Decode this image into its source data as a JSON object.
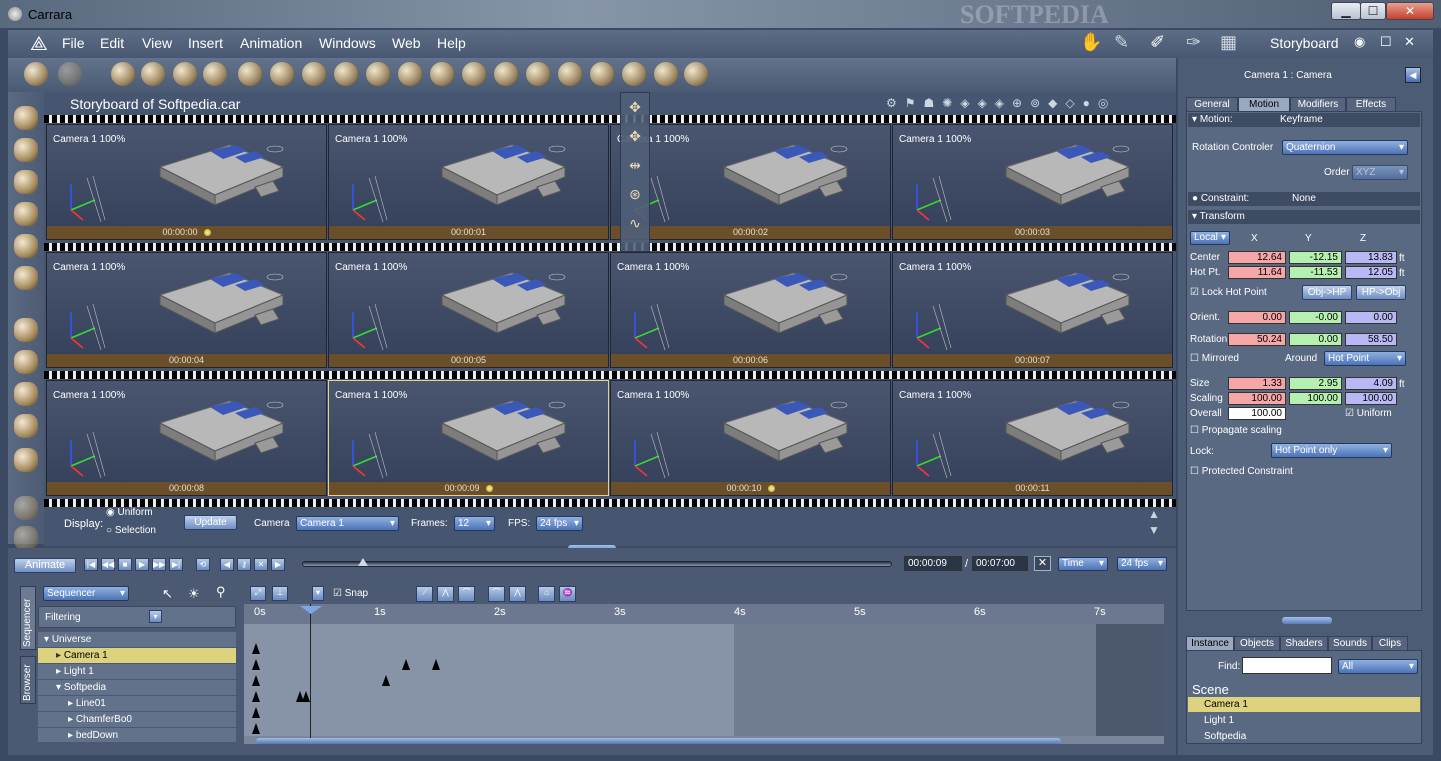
{
  "app": {
    "title": "Carrara",
    "watermark": "SOFTPEDIA"
  },
  "menu": [
    "File",
    "Edit",
    "View",
    "Insert",
    "Animation",
    "Windows",
    "Web",
    "Help"
  ],
  "room": {
    "label": "Storyboard"
  },
  "storyboard": {
    "title": "Storyboard of Softpedia.car",
    "frames": [
      {
        "label": "Camera 1 100%",
        "time": "00:00:00",
        "dot": true
      },
      {
        "label": "Camera 1 100%",
        "time": "00:00:01",
        "dot": false
      },
      {
        "label": "Camera 1 100%",
        "time": "00:00:02",
        "dot": false
      },
      {
        "label": "Camera 1 100%",
        "time": "00:00:03",
        "dot": false
      },
      {
        "label": "Camera 1 100%",
        "time": "00:00:04",
        "dot": false
      },
      {
        "label": "Camera 1 100%",
        "time": "00:00:05",
        "dot": false
      },
      {
        "label": "Camera 1 100%",
        "time": "00:00:06",
        "dot": false
      },
      {
        "label": "Camera 1 100%",
        "time": "00:00:07",
        "dot": false
      },
      {
        "label": "Camera 1 100%",
        "time": "00:00:08",
        "dot": false
      },
      {
        "label": "Camera 1 100%",
        "time": "00:00:09",
        "dot": true
      },
      {
        "label": "Camera 1 100%",
        "time": "00:00:10",
        "dot": true
      },
      {
        "label": "Camera 1 100%",
        "time": "00:00:11",
        "dot": false
      }
    ],
    "display_label": "Display:",
    "uniform": "Uniform",
    "selection": "Selection",
    "update": "Update",
    "camera_label": "Camera",
    "camera_value": "Camera 1",
    "frames_label": "Frames:",
    "frames_value": "12",
    "fps_label": "FPS:",
    "fps_value": "24 fps"
  },
  "props": {
    "header": "Camera 1 : Camera",
    "tabs": [
      "General",
      "Motion",
      "Modifiers",
      "Effects"
    ],
    "motion_label": "Motion:",
    "motion_value": "Keyframe",
    "rot_ctrl_label": "Rotation Controler",
    "rot_ctrl_value": "Quaternion",
    "order_label": "Order",
    "order_value": "XYZ",
    "constraint_label": "Constraint:",
    "constraint_value": "None",
    "transform_label": "Transform",
    "local": "Local",
    "x": "X",
    "y": "Y",
    "z": "Z",
    "center_label": "Center",
    "center": [
      "12.64",
      "-12.15",
      "13.83"
    ],
    "hotpt_label": "Hot Pt.",
    "hotpt": [
      "11.64",
      "-11.53",
      "12.05"
    ],
    "unit": "ft",
    "lock_hot": "Lock Hot Point",
    "obj_hp": "Obj->HP",
    "hp_obj": "HP->Obj",
    "orient_label": "Orient.",
    "orient": [
      "0.00",
      "-0.00",
      "0.00"
    ],
    "rotation_label": "Rotation",
    "rotation": [
      "50.24",
      "0.00",
      "58.50"
    ],
    "mirrored": "Mirrored",
    "around_label": "Around",
    "around_value": "Hot Point",
    "size_label": "Size",
    "size": [
      "1.33",
      "2.95",
      "4.09"
    ],
    "scaling_label": "Scaling",
    "scaling": [
      "100.00",
      "100.00",
      "100.00"
    ],
    "overall_label": "Overall",
    "overall": "100.00",
    "uniform": "Uniform",
    "propagate": "Propagate scaling",
    "lock_label": "Lock:",
    "lock_value": "Hot Point only",
    "protected": "Protected Constraint"
  },
  "browser": {
    "tabs": [
      "Instance",
      "Objects",
      "Shaders",
      "Sounds",
      "Clips"
    ],
    "find_label": "Find:",
    "find_filter": "All",
    "scene_label": "Scene",
    "items": [
      "Camera 1",
      "Light 1",
      "Softpedia"
    ]
  },
  "sequencer": {
    "animate": "Animate",
    "current_time": "00:00:09",
    "sep": "/",
    "total_time": "00:07:00",
    "time_mode": "Time",
    "fps": "24 fps",
    "mode": "Sequencer",
    "snap": "Snap",
    "filtering": "Filtering",
    "side_tabs": [
      "Sequencer",
      "Browser"
    ],
    "ticks": [
      "0s",
      "1s",
      "2s",
      "3s",
      "4s",
      "5s",
      "6s",
      "7s"
    ],
    "tracks": [
      {
        "label": "Universe",
        "indent": 0,
        "open": true
      },
      {
        "label": "Camera 1",
        "indent": 1,
        "hl": true
      },
      {
        "label": "Light 1",
        "indent": 1
      },
      {
        "label": "Softpedia",
        "indent": 1,
        "open": true
      },
      {
        "label": "Line01",
        "indent": 2
      },
      {
        "label": "ChamferBo0",
        "indent": 2
      },
      {
        "label": "bedDown",
        "indent": 2
      }
    ]
  }
}
